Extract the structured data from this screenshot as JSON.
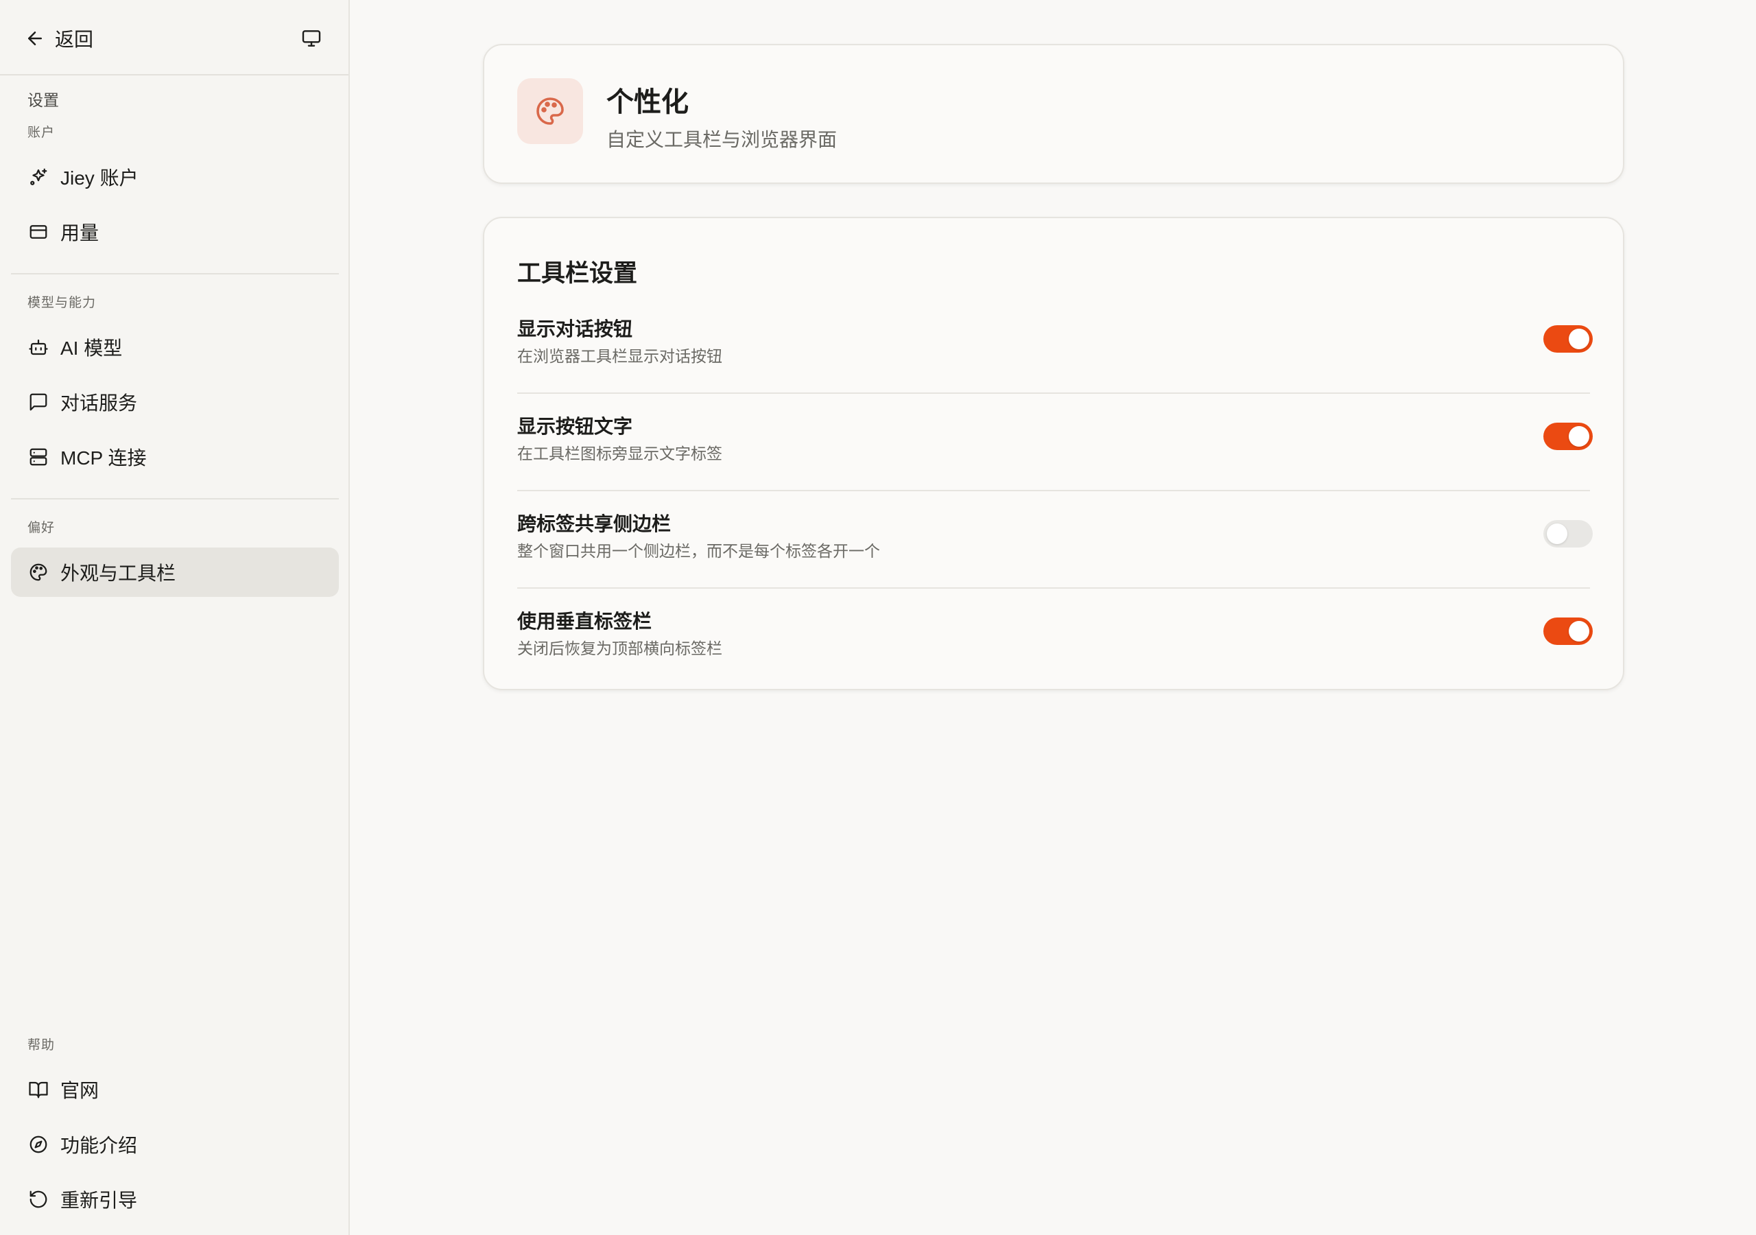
{
  "sidebar": {
    "back_label": "返回",
    "title": "设置",
    "sections": {
      "account": "账户",
      "models": "模型与能力",
      "preferences": "偏好",
      "help": "帮助"
    },
    "items": {
      "account": "Jiey 账户",
      "usage": "用量",
      "ai_models": "AI 模型",
      "chat_service": "对话服务",
      "mcp": "MCP 连接",
      "appearance": "外观与工具栏",
      "website": "官网",
      "features": "功能介绍",
      "reguide": "重新引导"
    },
    "active_item": "appearance"
  },
  "header": {
    "title": "个性化",
    "subtitle": "自定义工具栏与浏览器界面",
    "icon": "palette-icon"
  },
  "toolbar_settings": {
    "title": "工具栏设置",
    "rows": [
      {
        "title": "显示对话按钮",
        "desc": "在浏览器工具栏显示对话按钮",
        "enabled": true
      },
      {
        "title": "显示按钮文字",
        "desc": "在工具栏图标旁显示文字标签",
        "enabled": true
      },
      {
        "title": "跨标签共享侧边栏",
        "desc": "整个窗口共用一个侧边栏，而不是每个标签各开一个",
        "enabled": false
      },
      {
        "title": "使用垂直标签栏",
        "desc": "关闭后恢复为顶部横向标签栏",
        "enabled": true
      }
    ]
  },
  "colors": {
    "accent": "#eb4a12",
    "toggle_off": "#e8e7e4",
    "icon_bg": "#f8e6e0",
    "icon_fg": "#d9684a"
  }
}
